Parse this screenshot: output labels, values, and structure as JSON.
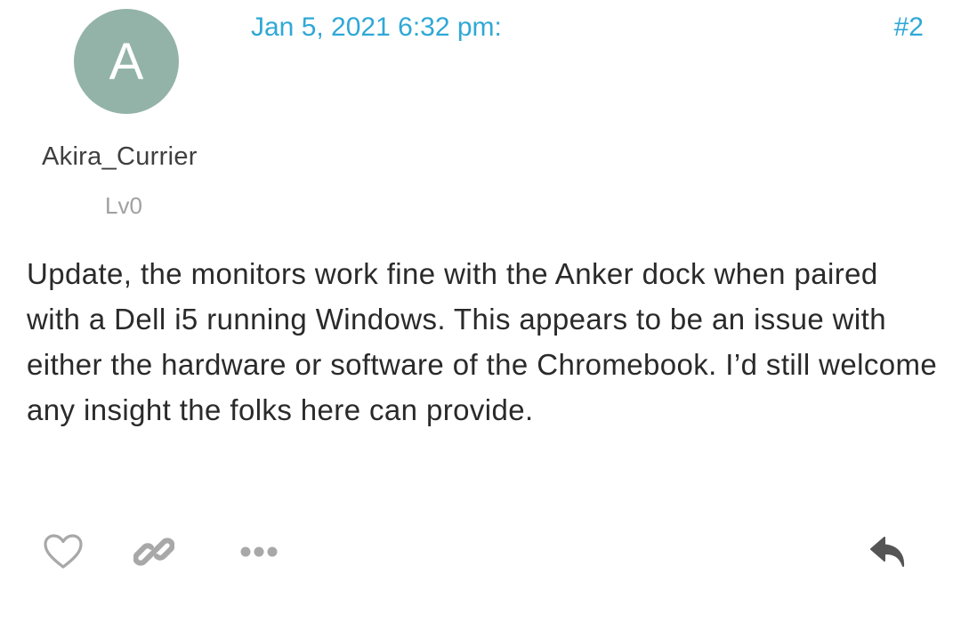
{
  "post": {
    "avatar_letter": "A",
    "username": "Akira_Currier",
    "level": "Lv0",
    "timestamp": "Jan 5, 2021 6:32 pm:",
    "post_number": "#2",
    "body": "Update, the monitors work fine with the Anker dock when paired with a Dell i5 running Windows. This appears to be an issue with either the hardware or software of the Chromebook. I’d still welcome any insight the folks here can provide."
  },
  "actions": {
    "like_icon": "heart-icon",
    "link_icon": "link-icon",
    "more_icon": "ellipsis-icon",
    "reply_icon": "reply-icon"
  },
  "colors": {
    "avatar_bg": "#93b3a9",
    "accent": "#2fa8d6",
    "icon_gray": "#a8a8a8",
    "reply_icon": "#555555"
  }
}
